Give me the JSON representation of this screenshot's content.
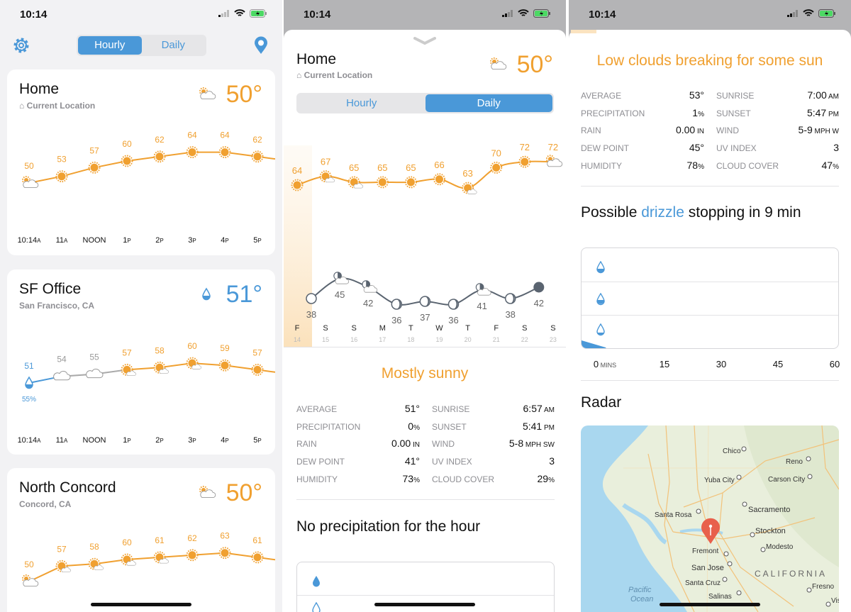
{
  "colors": {
    "orange": "#f0a030",
    "blue": "#4a98d8",
    "gray": "#8e8e93",
    "slate": "#5a6470"
  },
  "status": {
    "time": "10:14"
  },
  "hourly_screen": {
    "tabs": [
      {
        "label": "Hourly",
        "selected": true
      },
      {
        "label": "Daily",
        "selected": false
      }
    ],
    "settings_icon": "gear-icon",
    "location_icon": "map-pin-icon",
    "cards": [
      {
        "name": "Home",
        "subtitle": "Current Location",
        "subtitle_icon": "home-icon",
        "temp": "50°",
        "temp_color": "#f0a030",
        "icon": "partly-cloudy",
        "points": [
          {
            "temp": 50,
            "icon": "partly-cloudy"
          },
          {
            "temp": 53,
            "icon": "sun"
          },
          {
            "temp": 57,
            "icon": "sun"
          },
          {
            "temp": 60,
            "icon": "sun"
          },
          {
            "temp": 62,
            "icon": "sun"
          },
          {
            "temp": 64,
            "icon": "sun"
          },
          {
            "temp": 64,
            "icon": "sun"
          },
          {
            "temp": 62,
            "icon": "sun"
          }
        ],
        "times": [
          [
            "10:14",
            "A"
          ],
          [
            "11",
            "A"
          ],
          [
            "NOON",
            ""
          ],
          [
            "1",
            "P"
          ],
          [
            "2",
            "P"
          ],
          [
            "3",
            "P"
          ],
          [
            "4",
            "P"
          ],
          [
            "5",
            "P"
          ]
        ]
      },
      {
        "name": "SF Office",
        "subtitle": "San Francisco, CA",
        "temp": "51°",
        "temp_color": "#4a98d8",
        "icon": "drizzle",
        "precip": "55%",
        "points": [
          {
            "temp": 51,
            "icon": "drizzle"
          },
          {
            "temp": 54,
            "icon": "cloud"
          },
          {
            "temp": 55,
            "icon": "cloud"
          },
          {
            "temp": 57,
            "icon": "partly-sunny"
          },
          {
            "temp": 58,
            "icon": "partly-sunny"
          },
          {
            "temp": 60,
            "icon": "partly-sunny"
          },
          {
            "temp": 59,
            "icon": "sun"
          },
          {
            "temp": 57,
            "icon": "sun"
          }
        ],
        "times": [
          [
            "10:14",
            "A"
          ],
          [
            "11",
            "A"
          ],
          [
            "NOON",
            ""
          ],
          [
            "1",
            "P"
          ],
          [
            "2",
            "P"
          ],
          [
            "3",
            "P"
          ],
          [
            "4",
            "P"
          ],
          [
            "5",
            "P"
          ]
        ]
      },
      {
        "name": "North Concord",
        "subtitle": "Concord, CA",
        "temp": "50°",
        "temp_color": "#f0a030",
        "icon": "partly-cloudy",
        "points": [
          {
            "temp": 50,
            "icon": "partly-cloudy"
          },
          {
            "temp": 57,
            "icon": "partly-sunny"
          },
          {
            "temp": 58,
            "icon": "partly-sunny"
          },
          {
            "temp": 60,
            "icon": "partly-sunny"
          },
          {
            "temp": 61,
            "icon": "partly-sunny"
          },
          {
            "temp": 62,
            "icon": "sun"
          },
          {
            "temp": 63,
            "icon": "sun"
          },
          {
            "temp": 61,
            "icon": "sun"
          }
        ],
        "times": []
      }
    ]
  },
  "daily_screen": {
    "name": "Home",
    "subtitle": "Current Location",
    "temp": "50°",
    "icon": "partly-cloudy",
    "tabs": [
      {
        "label": "Hourly",
        "selected": false
      },
      {
        "label": "Daily",
        "selected": true
      }
    ],
    "chart_data": {
      "type": "line",
      "days": [
        [
          "F",
          "14"
        ],
        [
          "S",
          "15"
        ],
        [
          "S",
          "16"
        ],
        [
          "M",
          "17"
        ],
        [
          "T",
          "18"
        ],
        [
          "W",
          "19"
        ],
        [
          "T",
          "20"
        ],
        [
          "F",
          "21"
        ],
        [
          "S",
          "22"
        ],
        [
          "S",
          "23"
        ]
      ],
      "highs": [
        {
          "temp": 64,
          "icon": "sun"
        },
        {
          "temp": 67,
          "icon": "partly-sunny"
        },
        {
          "temp": 65,
          "icon": "partly-sunny"
        },
        {
          "temp": 65,
          "icon": "sun"
        },
        {
          "temp": 65,
          "icon": "sun"
        },
        {
          "temp": 66,
          "icon": "sun"
        },
        {
          "temp": 63,
          "icon": "partly-sunny"
        },
        {
          "temp": 70,
          "icon": "sun"
        },
        {
          "temp": 72,
          "icon": "sun"
        },
        {
          "temp": 72,
          "icon": "partly-cloudy"
        }
      ],
      "lows": [
        {
          "temp": 38,
          "icon": "moon-full"
        },
        {
          "temp": 45,
          "icon": "moon-half-cloud"
        },
        {
          "temp": 42,
          "icon": "moon-half-cloud"
        },
        {
          "temp": 36,
          "icon": "moon-crescent"
        },
        {
          "temp": 37,
          "icon": "moon-crescent"
        },
        {
          "temp": 36,
          "icon": "moon-crescent"
        },
        {
          "temp": 41,
          "icon": "moon-half-cloud"
        },
        {
          "temp": 38,
          "icon": "moon-crescent"
        },
        {
          "temp": 42,
          "icon": "moon-new"
        }
      ]
    },
    "summary": "Mostly sunny",
    "stats_left": [
      [
        "AVERAGE",
        "51°",
        ""
      ],
      [
        "PRECIPITATION",
        "0",
        "%"
      ],
      [
        "RAIN",
        "0.00",
        " IN"
      ],
      [
        "DEW POINT",
        "41°",
        ""
      ],
      [
        "HUMIDITY",
        "73",
        "%"
      ]
    ],
    "stats_right": [
      [
        "SUNRISE",
        "6:57",
        " AM"
      ],
      [
        "SUNSET",
        "5:41",
        " PM"
      ],
      [
        "WIND",
        "5-8",
        " MPH SW"
      ],
      [
        "UV INDEX",
        "3",
        ""
      ],
      [
        "CLOUD COVER",
        "29",
        "%"
      ]
    ],
    "precip_heading": "No precipitation for the hour"
  },
  "detail_screen": {
    "summary": "Low clouds breaking for some sun",
    "stats_left": [
      [
        "AVERAGE",
        "53°",
        ""
      ],
      [
        "PRECIPITATION",
        "1",
        "%"
      ],
      [
        "RAIN",
        "0.00",
        " IN"
      ],
      [
        "DEW POINT",
        "45°",
        ""
      ],
      [
        "HUMIDITY",
        "78",
        "%"
      ]
    ],
    "stats_right": [
      [
        "SUNRISE",
        "7:00",
        " AM"
      ],
      [
        "SUNSET",
        "5:47",
        " PM"
      ],
      [
        "WIND",
        "5-9",
        " MPH W"
      ],
      [
        "UV INDEX",
        "3",
        ""
      ],
      [
        "CLOUD COVER",
        "47",
        "%"
      ]
    ],
    "precip_heading_pre": "Possible ",
    "precip_heading_word": "drizzle",
    "precip_heading_post": " stopping in 9 min",
    "minute_axis": [
      [
        "0",
        " MINS"
      ],
      [
        "15",
        ""
      ],
      [
        "30",
        ""
      ],
      [
        "45",
        ""
      ],
      [
        "60",
        ""
      ]
    ],
    "radar_heading": "Radar",
    "map_labels": {
      "chico": "Chico",
      "reno": "Reno",
      "yuba": "Yuba City",
      "carson": "Carson City",
      "sacramento": "Sacramento",
      "santa_rosa": "Santa Rosa",
      "stockton": "Stockton",
      "fremont": "Fremont",
      "modesto": "Modesto",
      "san_jose": "San Jose",
      "california": "CALIFORNIA",
      "santa_cruz": "Santa Cruz",
      "fresno": "Fresno",
      "salinas": "Salinas",
      "pacific": "Pacific",
      "ocean": "Ocean",
      "visalia": "Vis"
    }
  }
}
